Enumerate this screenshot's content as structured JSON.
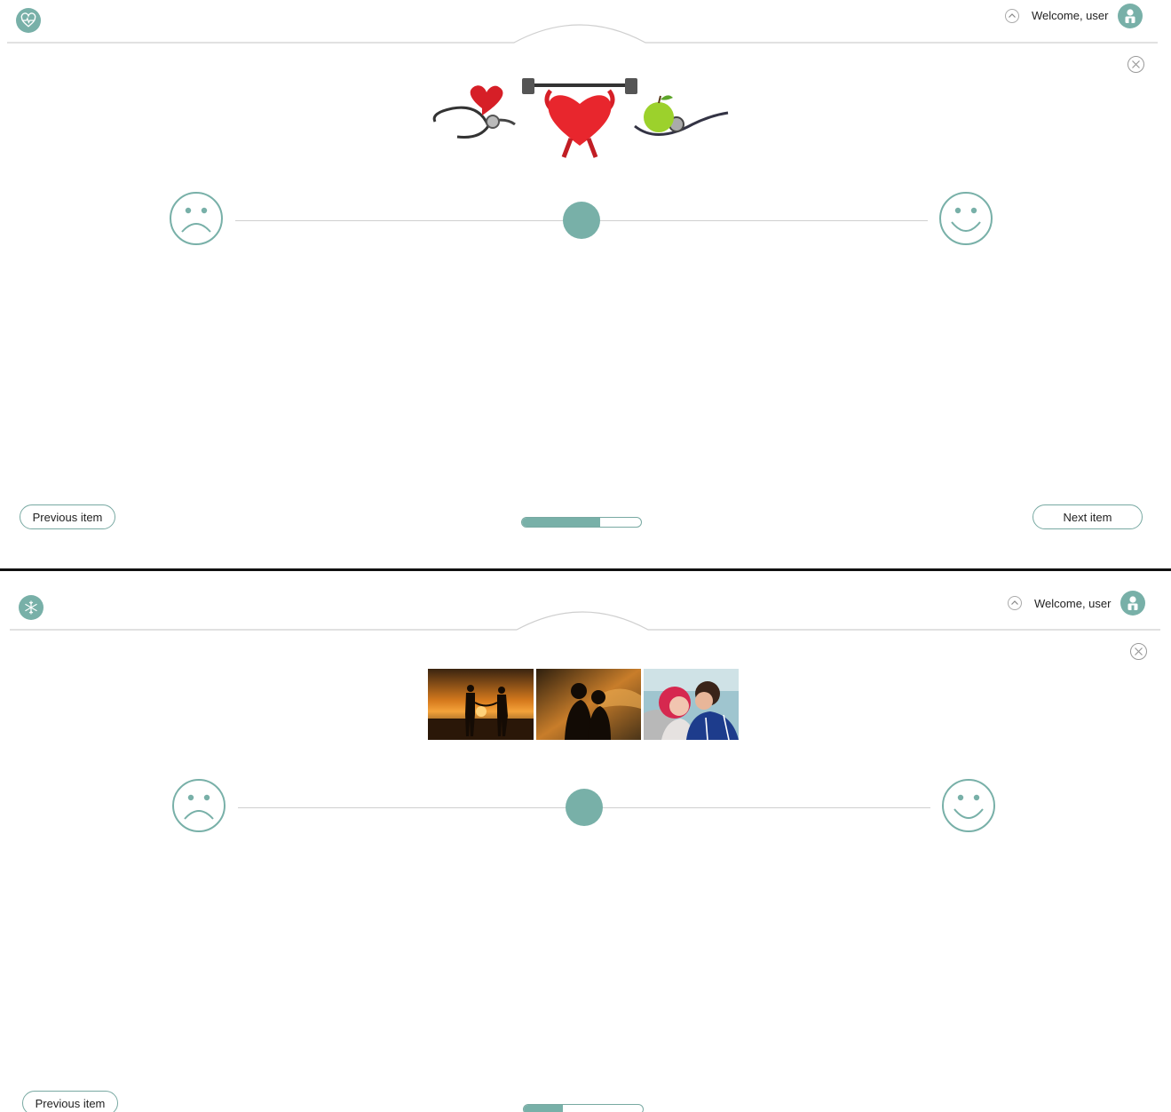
{
  "screens": [
    {
      "header": {
        "welcome_text": "Welcome, user",
        "app_icon": "heart-pulse-icon"
      },
      "item_image": "heart-fitness-illustration",
      "scale": {
        "min_icon": "sad-face-icon",
        "max_icon": "happy-face-icon",
        "value": 0.5
      },
      "nav": {
        "prev_label": "Previous item",
        "next_label": "Next item"
      },
      "progress": 0.66
    },
    {
      "header": {
        "welcome_text": "Welcome, user",
        "app_icon": "snowflake-icon"
      },
      "item_image": "couples-photo-strip",
      "scale": {
        "min_icon": "sad-face-icon",
        "max_icon": "happy-face-icon",
        "value": 0.5
      },
      "nav": {
        "prev_label": "Previous item"
      },
      "progress": 0.33
    }
  ],
  "colors": {
    "accent": "#78b0a8",
    "line": "#cfcfcf",
    "divider": "#111111"
  }
}
